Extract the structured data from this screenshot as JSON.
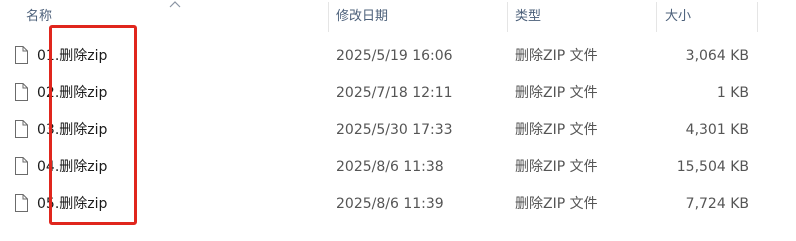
{
  "columns": {
    "name": "名称",
    "modified": "修改日期",
    "type": "类型",
    "size": "大小"
  },
  "sort": {
    "column": "name",
    "direction": "ascending",
    "icon": "chevron-up-icon"
  },
  "file_icon": "document-icon",
  "files": [
    {
      "name": "01.删除zip",
      "modified": "2025/5/19 16:06",
      "type": "删除ZIP 文件",
      "size": "3,064 KB"
    },
    {
      "name": "02.删除zip",
      "modified": "2025/7/18 12:11",
      "type": "删除ZIP 文件",
      "size": "1 KB"
    },
    {
      "name": "03.删除zip",
      "modified": "2025/5/30 17:33",
      "type": "删除ZIP 文件",
      "size": "4,301 KB"
    },
    {
      "name": "04.删除zip",
      "modified": "2025/8/6 11:38",
      "type": "删除ZIP 文件",
      "size": "15,504 KB"
    },
    {
      "name": "05.删除zip",
      "modified": "2025/8/6 11:39",
      "type": "删除ZIP 文件",
      "size": "7,724 KB"
    }
  ],
  "colors": {
    "highlight": "#e0261d",
    "header_text": "#4c607a"
  }
}
